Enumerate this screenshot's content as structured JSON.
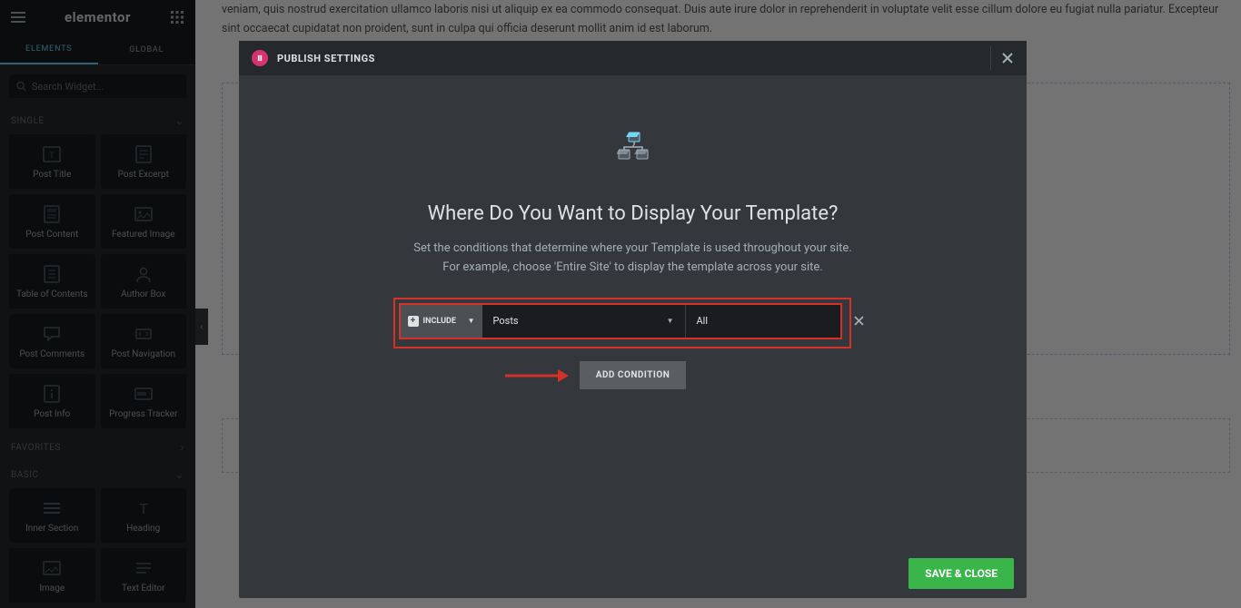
{
  "sidebar": {
    "brand": "elementor",
    "tabs": {
      "elements": "ELEMENTS",
      "global": "GLOBAL"
    },
    "search_placeholder": "Search Widget...",
    "sections": {
      "single": "SINGLE",
      "favorites": "FAVORITES",
      "basic": "BASIC"
    },
    "single_widgets": [
      {
        "label": "Post Title",
        "icon": "post-title-icon"
      },
      {
        "label": "Post Excerpt",
        "icon": "post-excerpt-icon"
      },
      {
        "label": "Post Content",
        "icon": "post-content-icon"
      },
      {
        "label": "Featured Image",
        "icon": "featured-image-icon"
      },
      {
        "label": "Table of Contents",
        "icon": "toc-icon"
      },
      {
        "label": "Author Box",
        "icon": "author-box-icon"
      },
      {
        "label": "Post Comments",
        "icon": "comments-icon"
      },
      {
        "label": "Post Navigation",
        "icon": "post-nav-icon"
      },
      {
        "label": "Post Info",
        "icon": "post-info-icon"
      },
      {
        "label": "Progress Tracker",
        "icon": "progress-icon"
      }
    ],
    "basic_widgets": [
      {
        "label": "Inner Section",
        "icon": "section-icon"
      },
      {
        "label": "Heading",
        "icon": "heading-icon"
      },
      {
        "label": "Image",
        "icon": "image-icon"
      },
      {
        "label": "Text Editor",
        "icon": "text-editor-icon"
      }
    ]
  },
  "content": {
    "lorem": "veniam, quis nostrud exercitation ullamco laboris nisi ut aliquip ex ea commodo consequat. Duis aute irure dolor in reprehenderit in voluptate velit esse cillum dolore eu fugiat nulla pariatur. Excepteur sint occaecat cupidatat non proident, sunt in culpa qui officia deserunt mollit anim id est laborum."
  },
  "modal": {
    "title": "PUBLISH SETTINGS",
    "heading": "Where Do You Want to Display Your Template?",
    "sub1": "Set the conditions that determine where your Template is used throughout your site.",
    "sub2": "For example, choose 'Entire Site' to display the template across your site.",
    "condition": {
      "type_label": "INCLUDE",
      "selector_value": "Posts",
      "match_value": "All"
    },
    "add_btn": "ADD CONDITION",
    "save_btn": "SAVE & CLOSE"
  }
}
